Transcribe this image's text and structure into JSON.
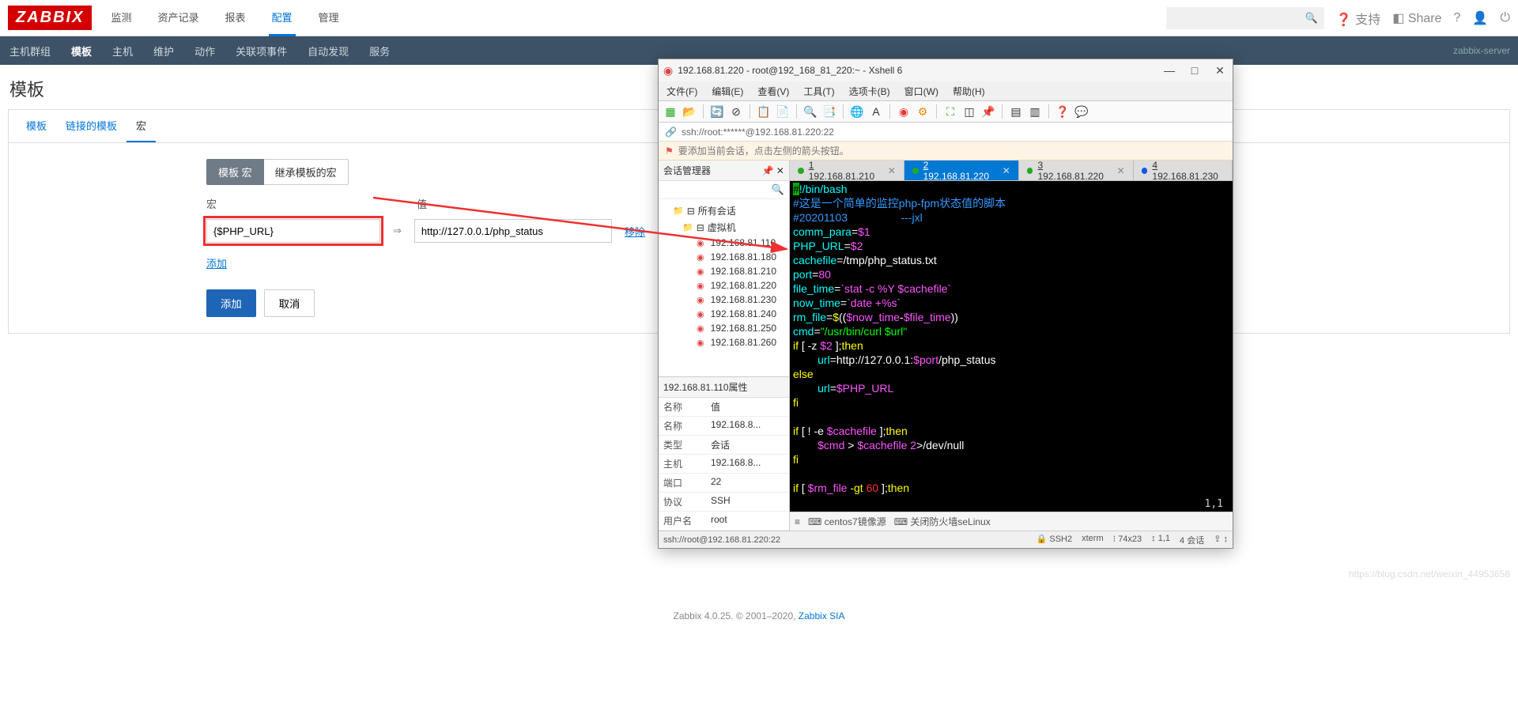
{
  "zabbix": {
    "logo": "ZABBIX",
    "nav": {
      "monitor": "监测",
      "inventory": "资产记录",
      "reports": "报表",
      "config": "配置",
      "admin": "管理"
    },
    "right": {
      "support": "支持",
      "share": "Share"
    },
    "subnav": {
      "hostgroups": "主机群组",
      "templates": "模板",
      "hosts": "主机",
      "maintenance": "维护",
      "actions": "动作",
      "correlation": "关联项事件",
      "discovery": "自动发现",
      "services": "服务",
      "server": "zabbix-server"
    },
    "title": "模板",
    "tabbar": {
      "template": "模板",
      "linked": "链接的模板",
      "macros": "宏"
    },
    "toggle": {
      "templateMacro": "模板 宏",
      "inheritedMacro": "继承模板的宏"
    },
    "labels": {
      "macro": "宏",
      "value": "值"
    },
    "macroRow": {
      "name": "{$PHP_URL}",
      "value": "http://127.0.0.1/php_status"
    },
    "removeLink": "移除",
    "addLink": "添加",
    "btnAdd": "添加",
    "btnCancel": "取消",
    "footer": {
      "text": "Zabbix 4.0.25. © 2001–2020, ",
      "link": "Zabbix SIA"
    }
  },
  "xshell": {
    "title": "192.168.81.220 - root@192_168_81_220:~ - Xshell 6",
    "menu": {
      "file": "文件(F)",
      "edit": "编辑(E)",
      "view": "查看(V)",
      "tools": "工具(T)",
      "tabs": "选项卡(B)",
      "window": "窗口(W)",
      "help": "帮助(H)"
    },
    "addr": "ssh://root:******@192.168.81.220:22",
    "hint": "要添加当前会话，点击左侧的箭头按钮。",
    "sideTitle": "会话管理器",
    "tree": {
      "root": "所有会话",
      "vm": "虚拟机",
      "hosts": [
        "192.168.81.110",
        "192.168.81.180",
        "192.168.81.210",
        "192.168.81.220",
        "192.168.81.230",
        "192.168.81.240",
        "192.168.81.250",
        "192.168.81.260"
      ]
    },
    "propsTitle": "192.168.81.110属性",
    "propHead": {
      "name": "名称",
      "val": "值"
    },
    "props": {
      "name_k": "名称",
      "name_v": "192.168.8...",
      "type_k": "类型",
      "type_v": "会话",
      "host_k": "主机",
      "host_v": "192.168.8...",
      "port_k": "端口",
      "port_v": "22",
      "proto_k": "协议",
      "proto_v": "SSH",
      "user_k": "用户名",
      "user_v": "root"
    },
    "tabs": {
      "t1_num": "1",
      "t1": "192.168.81.210",
      "t2_num": "2",
      "t2": "192.168.81.220",
      "t3_num": "3",
      "t3": "192.168.81.220",
      "t4_num": "4",
      "t4": "192.168.81.230"
    },
    "cursorPos": "1,1",
    "statusTabs": {
      "t1": "centos7镜像源",
      "t2": "关闭防火墙seLinux"
    },
    "statusBar": {
      "left": "ssh://root@192.168.81.220:22",
      "ssh": "SSH2",
      "term": "xterm",
      "size": "74x23",
      "pos": "1,1",
      "sess": "4 会话"
    }
  },
  "script": {
    "l1a": "#",
    "l1b": "!/bin/bash",
    "l2": "#这是一个简单的监控php-fpm状态值的脚本",
    "l3a": "#20201103",
    "l3b": "---jxl",
    "l4a": "comm_para",
    "l4b": "=",
    "l4c": "$1",
    "l5a": "PHP_URL",
    "l5b": "=",
    "l5c": "$2",
    "l6a": "cachefile",
    "l6b": "=/tmp/php_status.txt",
    "l7a": "port",
    "l7b": "=",
    "l7c": "80",
    "l8a": "file_time",
    "l8b": "=",
    "l8c": "`stat -c %Y $cachefile`",
    "l9a": "now_time",
    "l9b": "=",
    "l9c": "`date +%s`",
    "l10a": "rm_file",
    "l10b": "=",
    "l10c": "$",
    "l10d": "((",
    "l10e": "$now_time",
    "l10f": "-",
    "l10g": "$file_time",
    "l10h": "))",
    "l11a": "cmd",
    "l11b": "=",
    "l11c": "\"/usr/bin/curl $url\"",
    "l12a": "if",
    "l12b": " [ -z ",
    "l12c": "$2",
    "l12d": " ];",
    "l12e": "then",
    "l13a": "        url",
    "l13b": "=http://127.0.0.1:",
    "l13c": "$port",
    "l13d": "/php_status",
    "l14": "else",
    "l15a": "        url",
    "l15b": "=",
    "l15c": "$PHP_URL",
    "l16": "fi",
    "l17": "",
    "l18a": "if",
    "l18b": " [ ! -e ",
    "l18c": "$cachefile",
    "l18d": " ];",
    "l18e": "then",
    "l19a": "        $cmd",
    "l19b": " > ",
    "l19c": "$cachefile",
    "l19d": " 2",
    "l19e": ">/dev/null",
    "l20": "fi",
    "l21": "",
    "l22a": "if",
    "l22b": " [ ",
    "l22c": "$rm_file",
    "l22d": " -gt ",
    "l22e": "60",
    "l22f": " ];",
    "l22g": "then"
  },
  "watermark": "https://blog.csdn.net/weixin_44953658"
}
